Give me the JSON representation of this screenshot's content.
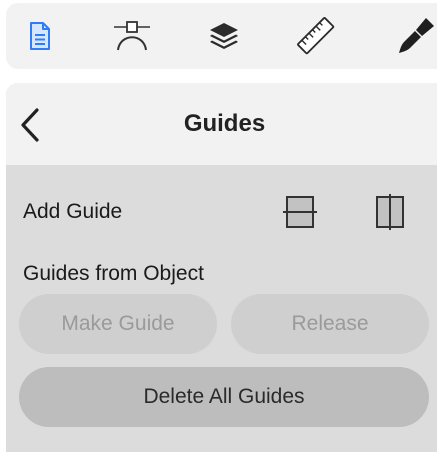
{
  "toolbar": {
    "tools": [
      {
        "icon": "document-icon",
        "active": true
      },
      {
        "icon": "bezier-node-icon",
        "active": false
      },
      {
        "icon": "layers-icon",
        "active": false
      },
      {
        "icon": "ruler-icon",
        "active": false
      },
      {
        "icon": "brush-icon",
        "active": false
      }
    ],
    "accent_color": "#2f7df6"
  },
  "panel": {
    "title": "Guides",
    "back_icon": "chevron-left-icon",
    "add_guide_label": "Add Guide",
    "add_horizontal_icon": "horizontal-guide-icon",
    "add_vertical_icon": "vertical-guide-icon",
    "guides_from_object_label": "Guides from Object",
    "make_guide_label": "Make Guide",
    "release_label": "Release",
    "delete_all_label": "Delete All Guides"
  }
}
